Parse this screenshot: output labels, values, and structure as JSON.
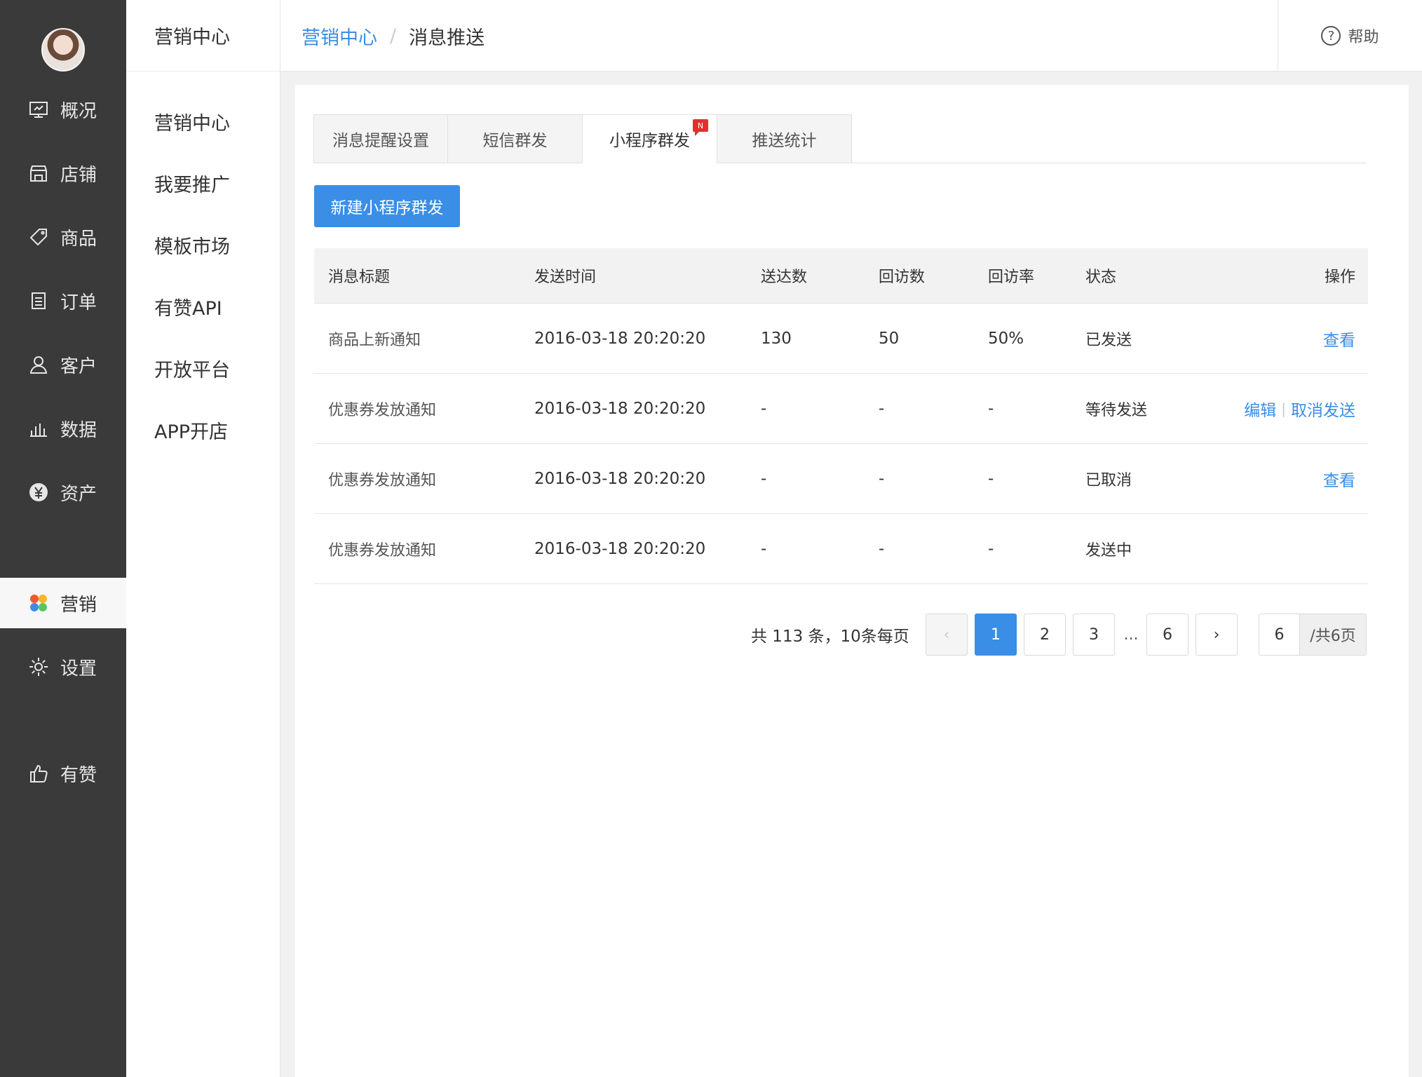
{
  "nav": {
    "items": [
      {
        "label": "概况",
        "icon": "dashboard-icon"
      },
      {
        "label": "店铺",
        "icon": "store-icon"
      },
      {
        "label": "商品",
        "icon": "tag-icon"
      },
      {
        "label": "订单",
        "icon": "order-icon"
      },
      {
        "label": "客户",
        "icon": "customer-icon"
      },
      {
        "label": "数据",
        "icon": "chart-icon"
      },
      {
        "label": "资产",
        "icon": "yen-icon"
      },
      {
        "label": "营销",
        "icon": "marketing-icon"
      },
      {
        "label": "设置",
        "icon": "gear-icon"
      },
      {
        "label": "有赞",
        "icon": "thumbs-up-icon"
      }
    ],
    "active_index": 7
  },
  "subnav": {
    "title": "营销中心",
    "items": [
      "营销中心",
      "我要推广",
      "模板市场",
      "有赞API",
      "开放平台",
      "APP开店"
    ]
  },
  "header": {
    "breadcrumb_parent": "营销中心",
    "breadcrumb_current": "消息推送",
    "help_label": "帮助"
  },
  "tabs": {
    "items": [
      "消息提醒设置",
      "短信群发",
      "小程序群发",
      "推送统计"
    ],
    "active_index": 2,
    "badge": "N"
  },
  "toolbar": {
    "new_button": "新建小程序群发"
  },
  "table": {
    "headers": {
      "title": "消息标题",
      "time": "发送时间",
      "delivered": "送达数",
      "visits": "回访数",
      "rate": "回访率",
      "status": "状态",
      "ops": "操作"
    },
    "rows": [
      {
        "title": "商品上新通知",
        "time": "2016-03-18 20:20:20",
        "delivered": "130",
        "visits": "50",
        "rate": "50%",
        "status": "已发送",
        "op_view": "查看"
      },
      {
        "title": "优惠券发放通知",
        "time": "2016-03-18 20:20:20",
        "delivered": "-",
        "visits": "-",
        "rate": "-",
        "status": "等待发送",
        "op_edit": "编辑",
        "op_sep": "|",
        "op_cancel": "取消发送"
      },
      {
        "title": "优惠券发放通知",
        "time": "2016-03-18 20:20:20",
        "delivered": "-",
        "visits": "-",
        "rate": "-",
        "status": "已取消",
        "op_view": "查看"
      },
      {
        "title": "优惠券发放通知",
        "time": "2016-03-18 20:20:20",
        "delivered": "-",
        "visits": "-",
        "rate": "-",
        "status": "发送中"
      }
    ]
  },
  "pagination": {
    "total_text": "共 113 条，10条每页",
    "prev": "‹",
    "pages": [
      "1",
      "2",
      "3",
      "6"
    ],
    "ellipsis": "...",
    "next": "›",
    "current": "1",
    "jump_value": "6",
    "jump_total": "/共6页"
  }
}
